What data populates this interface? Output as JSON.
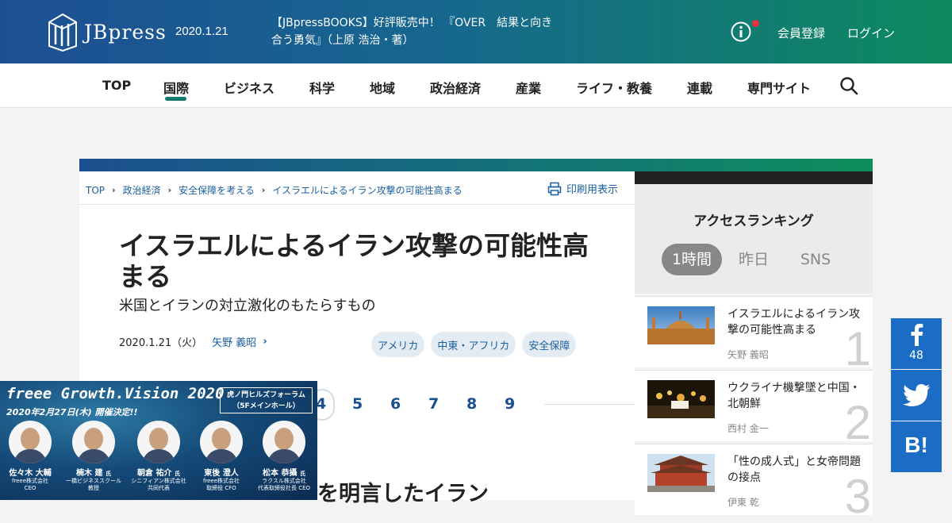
{
  "header": {
    "logo_text": "JBpress",
    "date": "2020.1.21",
    "promo": "【JBpressBOOKS】好評販売中！ 『OVER　結果と向き合う勇気』（上原 浩治・著）",
    "member_register": "会員登録",
    "login": "ログイン"
  },
  "nav": {
    "items": [
      "TOP",
      "国際",
      "ビジネス",
      "科学",
      "地域",
      "政治経済",
      "産業",
      "ライフ・教養",
      "連載",
      "専門サイト"
    ],
    "active": "国際"
  },
  "breadcrumb": [
    "TOP",
    "政治経済",
    "安全保障を考える",
    "イスラエルによるイラン攻撃の可能性高まる"
  ],
  "print_label": "印刷用表示",
  "article": {
    "title": "イスラエルによるイラン攻撃の可能性高まる",
    "subtitle": "米国とイランの対立激化のもたらすもの",
    "date": "2020.1.21（火）",
    "author": "矢野 義昭",
    "tags": [
      "アメリカ",
      "中東・アフリカ",
      "安全保障"
    ],
    "pages": [
      "4",
      "5",
      "6",
      "7",
      "8",
      "9"
    ],
    "current_page": "4",
    "section_heading_partial": "を明言したイラン"
  },
  "ranking": {
    "title": "アクセスランキング",
    "tabs": [
      "1時間",
      "昨日",
      "SNS"
    ],
    "active_tab": "1時間",
    "items": [
      {
        "rank": "1",
        "title": "イスラエルによるイラン攻撃の可能性高まる",
        "author": "矢野 義昭"
      },
      {
        "rank": "2",
        "title": "ウクライナ機撃墜と中国・北朝鮮",
        "author": "西村 金一"
      },
      {
        "rank": "3",
        "title": "「性の成人式」と女帝問題の接点",
        "author": "伊東 乾"
      }
    ]
  },
  "social": {
    "facebook_count": "48",
    "hatena_label": "B!"
  },
  "ad": {
    "title": "freee Growth.Vision 2020",
    "date_line": "2020年2月27日(木) 開催決定!!",
    "venue_line1": "虎ノ門ヒルズフォーラム",
    "venue_line2": "（5Fメインホール）",
    "speakers": [
      {
        "name": "佐々木 大輔",
        "org1": "freee株式会社",
        "org2": "CEO"
      },
      {
        "name": "楠木 建",
        "suffix": "氏",
        "org1": "一橋ビジネススクール",
        "org2": "教授"
      },
      {
        "name": "朝倉 祐介",
        "suffix": "氏",
        "org1": "シニフィアン株式会社",
        "org2": "共同代表"
      },
      {
        "name": "東後 澄人",
        "org1": "freee株式会社",
        "org2": "取締役 CFO"
      },
      {
        "name": "松本 恭攝",
        "suffix": "氏",
        "org1": "ラクスル株式会社",
        "org2": "代表取締役社長 CEO"
      }
    ]
  },
  "colors": {
    "header_left": "#1d4f94",
    "header_right": "#0d8a5f",
    "link": "#1c5fa0",
    "nav_active": "#117a6e",
    "social": "#1a6cc4"
  }
}
